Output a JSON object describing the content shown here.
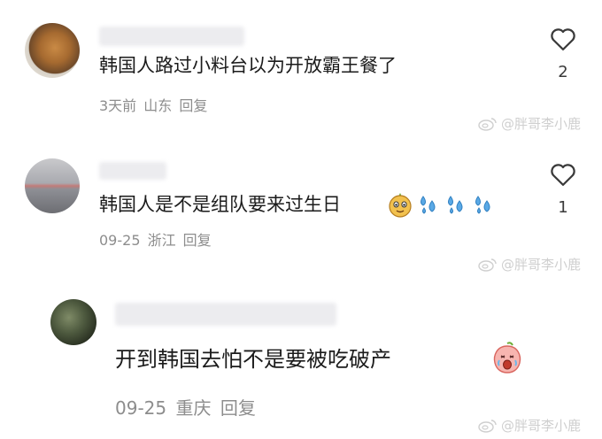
{
  "comments": [
    {
      "text": "韩国人路过小料台以为开放霸王餐了",
      "meta": "3天前 山东 回复",
      "likes": "2"
    },
    {
      "text": "韩国人是不是组队要来过生日",
      "meta": "09-25 浙江 回复",
      "likes": "1",
      "emojis": [
        "face-emoji",
        "sweat-drops-icon",
        "sweat-drops-icon",
        "sweat-drops-icon"
      ]
    }
  ],
  "reply": {
    "text": "开到韩国去怕不是要被吃破产",
    "meta": "09-25 重庆 回复",
    "emoji": "peach-crying-emoji"
  },
  "watermark": {
    "text": "@胖哥李小鹿"
  },
  "icons": {
    "like": "heart-outline-icon",
    "watermark_logo": "weibo-logo"
  },
  "colors": {
    "text": "#1b1b1b",
    "meta": "#8d8d8d",
    "watermark": "#cfcfcf"
  }
}
